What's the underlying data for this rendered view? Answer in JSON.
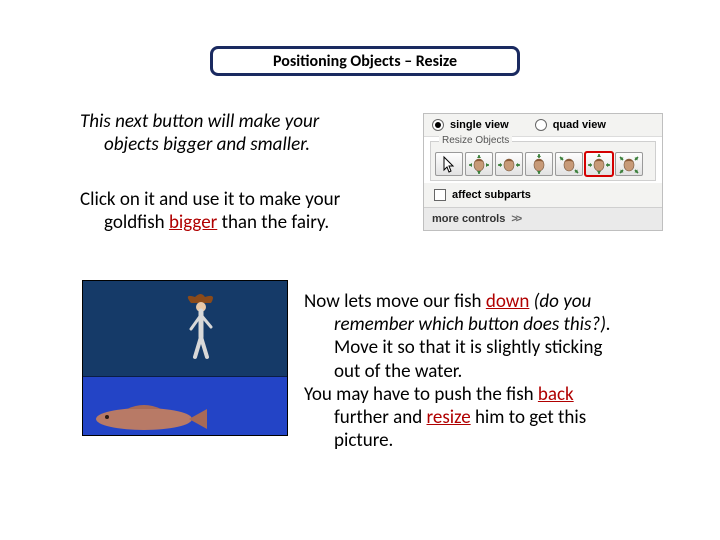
{
  "title": "Positioning Objects – Resize",
  "para1": {
    "l1": "This next button will make your",
    "l2": "objects bigger and smaller."
  },
  "para2": {
    "l1": "Click on it and use it to make your",
    "l2_a": "goldfish ",
    "l2_kw": "bigger",
    "l2_b": " than the fairy."
  },
  "panel": {
    "single_view": "single view",
    "quad_view": "quad view",
    "resize_objects": "Resize Objects",
    "affect_subparts": "affect subparts",
    "more_controls": "more controls",
    "chev": ">>",
    "tools": [
      {
        "name": "arrow-tool",
        "selected": false
      },
      {
        "name": "resize-uniform-tool",
        "selected": false
      },
      {
        "name": "resize-horizontal-tool",
        "selected": false
      },
      {
        "name": "resize-vertical-tool",
        "selected": false
      },
      {
        "name": "resize-depth-tool",
        "selected": false
      },
      {
        "name": "resize-all-tool",
        "selected": true
      },
      {
        "name": "resize-free-tool",
        "selected": false
      }
    ]
  },
  "para3": {
    "l1_a": "Now lets move our fish ",
    "l1_kw": "down",
    "l1_b": " ",
    "l1_par": "(do you",
    "l2_par": "remember which button does this?).",
    "l3": "Move it so that it is slightly sticking",
    "l4": "out of the water.",
    "l5_a": "You may have to push the fish ",
    "l5_kw": "back",
    "l6_a": "further and ",
    "l6_kw": "resize",
    "l6_b": " him to get this",
    "l7": "picture."
  }
}
